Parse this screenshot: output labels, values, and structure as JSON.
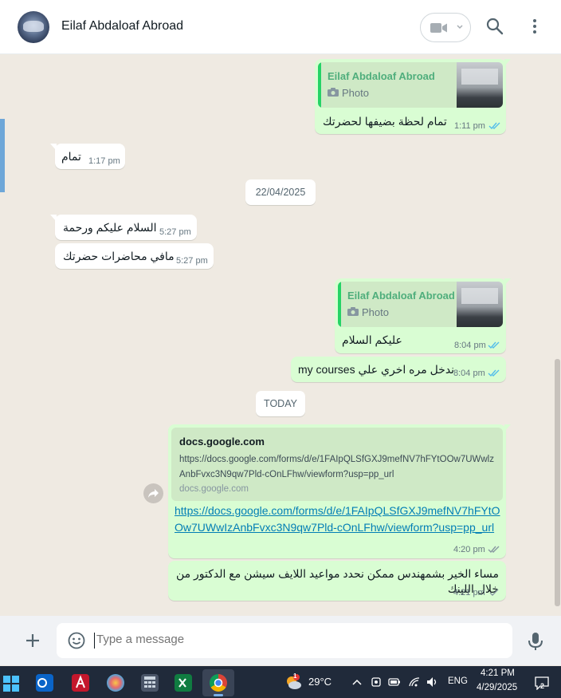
{
  "header": {
    "contact_name": "Eilaf Abdaloaf Abroad"
  },
  "messages": [
    {
      "kind": "out-quote",
      "quote_name": "Eilaf Abdaloaf Abroad",
      "quote_type": "Photo",
      "text": "تمام لحظة بضيفها لحضرتك",
      "time": "1:11 pm"
    },
    {
      "kind": "in",
      "text": "تمام",
      "time": "1:17 pm"
    },
    {
      "kind": "date",
      "text": "22/04/2025"
    },
    {
      "kind": "in",
      "text": "السلام عليكم ورحمة",
      "time": "5:27 pm"
    },
    {
      "kind": "in",
      "text": "مافي محاضرات حضرتك",
      "time": "5:27 pm"
    },
    {
      "kind": "out-quote",
      "quote_name": "Eilaf Abdaloaf Abroad",
      "quote_type": "Photo",
      "text": "عليكم السلام",
      "time": "8:04 pm"
    },
    {
      "kind": "out",
      "text": "ندخل مره اخري علي my courses",
      "time": "8:04 pm"
    },
    {
      "kind": "date",
      "text": "TODAY"
    },
    {
      "kind": "out-link",
      "link_domain": "docs.google.com",
      "link_desc": "https://docs.google.com/forms/d/e/1FAIpQLSfGXJ9mefNV7hFYtOOw7UWwlzAnbFvxc3N9qw7Pld-cOnLFhw/viewform?usp=pp_url",
      "link_site": "docs.google.com",
      "url": "https://docs.google.com/forms/d/e/1FAIpQLSfGXJ9mefNV7hFYtOOw7UWwIzAnbFvxc3N9qw7Pld-cOnLFhw/viewform?usp=pp_url",
      "time": "4:20 pm"
    },
    {
      "kind": "out",
      "text": "مساء الخير بشمهندس ممكن نحدد مواعيد اللايف سيشن مع الدكتور من خلال اللينك",
      "time": "4:21 pm"
    }
  ],
  "composer": {
    "placeholder": "Type a message"
  },
  "taskbar": {
    "weather_temp": "29°C",
    "weather_badge": "1",
    "language": "ENG",
    "time": "4:21 PM",
    "date": "4/29/2025",
    "notification_count": "2"
  },
  "colors": {
    "outgoing_bubble": "#d9fdd3",
    "incoming_bubble": "#ffffff",
    "chat_background": "#efeae2",
    "read_tick": "#53bdeb",
    "link": "#027eb5",
    "accent_green": "#25d366"
  }
}
